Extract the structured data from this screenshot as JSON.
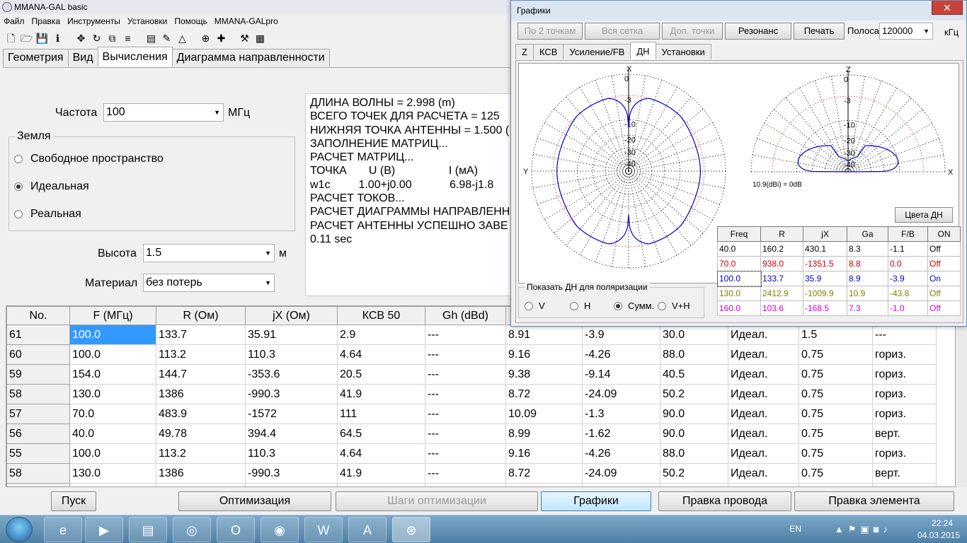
{
  "app_title": "MMANA-GAL basic",
  "menu": [
    "Файл",
    "Правка",
    "Инструменты",
    "Установки",
    "Помощь",
    "MMANA-GALpro"
  ],
  "toolbar_icons": [
    "new-file-icon",
    "open-folder-icon",
    "save-icon",
    "info-icon",
    "sep",
    "move-icon",
    "rotate-icon",
    "copy-icon",
    "wires-icon",
    "sep",
    "page-icon",
    "edit-icon",
    "triangle-icon",
    "sep",
    "target-icon",
    "add-icon",
    "sep",
    "tools-icon",
    "calculator-icon"
  ],
  "main_tabs": [
    "Геометрия",
    "Вид",
    "Вычисления",
    "Диаграмма направленности"
  ],
  "active_main_tab": "Вычисления",
  "calc": {
    "freq_label": "Частота",
    "freq_value": "100",
    "freq_unit": "МГц",
    "ground_title": "Земля",
    "ground_options": [
      "Свободное пространство",
      "Идеальная",
      "Реальная"
    ],
    "ground_selected": "Идеальная",
    "height_label": "Высота",
    "height_value": "1.5",
    "height_unit": "м",
    "material_label": "Материал",
    "material_value": "без потерь"
  },
  "log_lines": [
    "ДЛИНА ВОЛНЫ = 2.998 (m)",
    "ВСЕГО ТОЧЕК ДЛЯ РАСЧЕТА = 125",
    "НИЖНЯЯ ТОЧКА АНТЕННЫ = 1.500 (",
    "ЗАПОЛНЕНИЕ МАТРИЦ...",
    "РАСЧЕТ МАТРИЦ...",
    "ТОЧКА       U (В)                 I (мА)",
    "w1c         1.00+j0.00            6.98-j1.8",
    "РАСЧЕТ ТОКОВ...",
    "РАСЧЕТ ДИАГРАММЫ НАПРАВЛЕННО",
    "РАСЧЕТ АНТЕННЫ УСПЕШНО ЗАВЕ",
    "0.11 sec"
  ],
  "results_table": {
    "columns": [
      "No.",
      "F (МГц)",
      "R (Ом)",
      "jX (Ом)",
      "КСВ 50",
      "Gh (dBd)",
      "",
      "",
      "",
      "",
      "",
      ""
    ],
    "rows": [
      [
        "61",
        "100.0",
        "133.7",
        "35.91",
        "2.9",
        "---",
        "8.91",
        "-3.9",
        "30.0",
        "Идеал.",
        "1.5",
        "---"
      ],
      [
        "60",
        "100.0",
        "113.2",
        "110.3",
        "4.64",
        "---",
        "9.16",
        "-4.26",
        "88.0",
        "Идеал.",
        "0.75",
        "гориз."
      ],
      [
        "59",
        "154.0",
        "144.7",
        "-353.6",
        "20.5",
        "---",
        "9.38",
        "-9.14",
        "40.5",
        "Идеал.",
        "0.75",
        "гориз."
      ],
      [
        "58",
        "130.0",
        "1386",
        "-990.3",
        "41.9",
        "---",
        "8.72",
        "-24.09",
        "50.2",
        "Идеал.",
        "0.75",
        "гориз."
      ],
      [
        "57",
        "70.0",
        "483.9",
        "-1572",
        "111",
        "---",
        "10.09",
        "-1.3",
        "90.0",
        "Идеал.",
        "0.75",
        "гориз."
      ],
      [
        "56",
        "40.0",
        "49.78",
        "394.4",
        "64.5",
        "---",
        "8.99",
        "-1.62",
        "90.0",
        "Идеал.",
        "0.75",
        "верт."
      ],
      [
        "55",
        "100.0",
        "113.2",
        "110.3",
        "4.64",
        "---",
        "9.16",
        "-4.26",
        "88.0",
        "Идеал.",
        "0.75",
        "гориз."
      ],
      [
        "58",
        "130.0",
        "1386",
        "-990.3",
        "41.9",
        "---",
        "8.72",
        "-24.09",
        "50.2",
        "Идеал.",
        "0.75",
        "верт."
      ],
      [
        "",
        "",
        "",
        "",
        "",
        "",
        "",
        "",
        "",
        "",
        "",
        ""
      ]
    ]
  },
  "bottom_buttons": [
    "Пуск",
    "Оптимизация",
    "Шаги оптимизации",
    "Графики",
    "Правка провода",
    "Правка элемента"
  ],
  "graphs": {
    "title": "Графики",
    "close_glyph": "✕",
    "toolbar": [
      "По 2 точкам",
      "Вся сетка",
      "Доп. точки",
      "Резонанс",
      "Печать"
    ],
    "band_label": "Полоса",
    "band_value": "120000",
    "band_unit": "кГц",
    "tabs": [
      "Z",
      "КСВ",
      "Усиление/FB",
      "ДН",
      "Установки"
    ],
    "active_tab": "ДН",
    "left_plot": {
      "axis_top": "X",
      "axis_left": "Y",
      "rings": [
        "0",
        "-3",
        "-10",
        "-20",
        "-30",
        "-40"
      ]
    },
    "right_plot": {
      "axis_top": "Z",
      "axis_right": "X",
      "rings": [
        "0",
        "-3",
        "-10",
        "-20",
        "-30",
        "-40"
      ]
    },
    "gain_ref": "10.9(dBi) = 0dB",
    "colors_button": "Цвета ДН",
    "table": {
      "columns": [
        "Freq",
        "R",
        "jX",
        "Ga",
        "F/B",
        "ON"
      ],
      "rows": [
        {
          "cells": [
            "40.0",
            "160.2",
            "430.1",
            "8.3",
            "-1.1",
            "Off"
          ],
          "color": "#000000"
        },
        {
          "cells": [
            "70.0",
            "938.0",
            "-1351.5",
            "8.8",
            "0.0",
            "Off"
          ],
          "color": "#d00000"
        },
        {
          "cells": [
            "100.0",
            "133.7",
            "35.9",
            "8.9",
            "-3.9",
            "On"
          ],
          "color": "#0000c8"
        },
        {
          "cells": [
            "130.0",
            "2412.9",
            "-1009.9",
            "10.9",
            "-43.8",
            "Off"
          ],
          "color": "#808000"
        },
        {
          "cells": [
            "160.0",
            "103.6",
            "-168.5",
            "7.3",
            "-1.0",
            "Off"
          ],
          "color": "#d000d0"
        }
      ]
    },
    "polarization_title": "Показать ДН для поляризации",
    "polarization_options": [
      "V",
      "H",
      "Сумм.",
      "V+H"
    ],
    "polarization_selected": "Сумм."
  },
  "taskbar": {
    "items": [
      "ie-icon",
      "media-player-icon",
      "file-manager-icon",
      "mmana-icon",
      "opera-icon",
      "firefox-icon",
      "word-icon",
      "acrobat-icon",
      "mmana-gal-icon"
    ],
    "lang": "EN",
    "time": "22:24",
    "date": "04.03.2015"
  }
}
